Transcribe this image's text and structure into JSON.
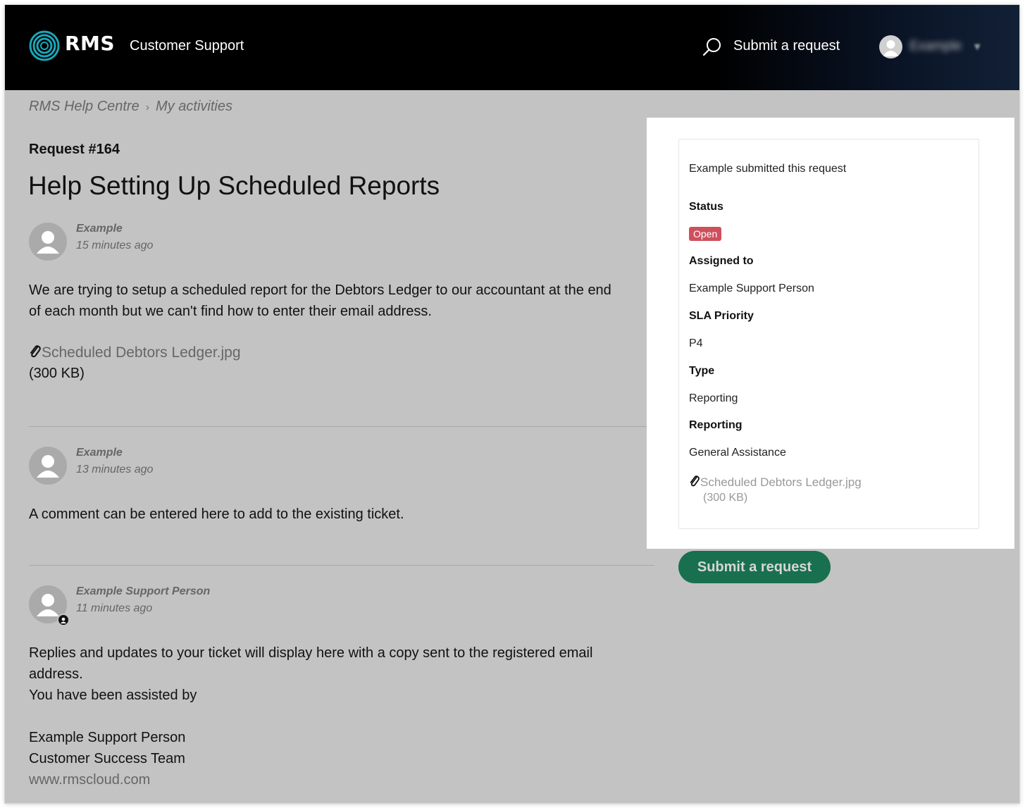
{
  "header": {
    "logo_text": "RMS",
    "subtitle": "Customer Support",
    "submit_request": "Submit a request",
    "user_name": "Example"
  },
  "breadcrumb": {
    "items": [
      "RMS Help Centre",
      "My activities"
    ],
    "separator": "›"
  },
  "request": {
    "number": "Request #164",
    "title": "Help Setting Up Scheduled Reports"
  },
  "comments": [
    {
      "author": "Example",
      "time": "15 minutes ago",
      "body_lines": [
        "We are trying to setup a scheduled report for the Debtors Ledger to our accountant at the end",
        "of each month but we can't find how to enter their email address."
      ],
      "attachment": {
        "name": "Scheduled Debtors Ledger.jpg",
        "size": "(300 KB)"
      }
    },
    {
      "author": "Example",
      "time": "13 minutes ago",
      "body_lines": [
        "A comment can be entered here to add to the existing ticket."
      ]
    },
    {
      "author": "Example Support Person",
      "time": "11 minutes ago",
      "is_agent": true,
      "body_lines": [
        "Replies and updates to your ticket will display here with a copy sent to the registered email",
        "address.",
        "You have been assisted by",
        "",
        "Example Support Person",
        "Customer Success Team"
      ],
      "link": "www.rmscloud.com"
    }
  ],
  "sidebar": {
    "submitted_by": "Example submitted this request",
    "status_label": "Status",
    "status_value": "Open",
    "assigned_label": "Assigned to",
    "assigned_value": "Example Support Person",
    "sla_label": "SLA Priority",
    "sla_value": "P4",
    "type_label": "Type",
    "type_value": "Reporting",
    "reporting_label": "Reporting",
    "reporting_value": "General Assistance",
    "attachment_name": "Scheduled Debtors Ledger.jpg",
    "attachment_size": "(300 KB)"
  },
  "submit_button": "Submit a request",
  "colors": {
    "header_bg": "#000000",
    "overlay": "#c3c3c3",
    "status_open": "#cf4f5c",
    "submit_green": "#0b6a45",
    "logo_teal": "#1aa6b7"
  },
  "icons": [
    "rms-logo-icon",
    "search-icon",
    "user-avatar-icon",
    "paperclip-icon",
    "agent-badge-icon"
  ]
}
